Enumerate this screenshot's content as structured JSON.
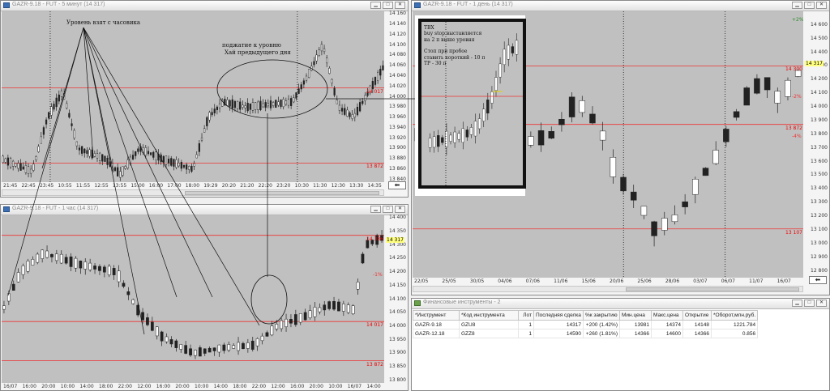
{
  "windows": {
    "top_left": {
      "title": "GAZR-9.18 - FUT - 5 минут (14 317)"
    },
    "bottom_left": {
      "title": "GAZR-9.18 - FUT - 1 час (14 317)"
    },
    "right": {
      "title": "GAZR-9.18 - FUT - 1 день (14 317)"
    },
    "instruments": {
      "title": "Финансовые инструменты - 2"
    }
  },
  "chart_data": [
    {
      "type": "candlestick",
      "timeframe": "5 минут",
      "yticks": [
        "14 160",
        "14 140",
        "14 120",
        "14 100",
        "14 080",
        "14 060",
        "14 040",
        "14 020",
        "14 000",
        "13 980",
        "13 960",
        "13 940",
        "13 920",
        "13 900",
        "13 880",
        "13 860",
        "13 840"
      ],
      "xticks": [
        "21:45",
        "22:45",
        "23:45",
        "10:55",
        "11:55",
        "12:55",
        "13:55",
        "15:00",
        "16:00",
        "17:00",
        "18:00",
        "19:29",
        "20:20",
        "21:20",
        "22:20",
        "23:20",
        "10:30",
        "11:30",
        "12:30",
        "13:30",
        "14:35"
      ],
      "ylim": [
        13835,
        14165
      ],
      "hlines": [
        14017,
        13872
      ],
      "hline_labels": [
        "14 017",
        "13 872"
      ]
    },
    {
      "type": "candlestick",
      "timeframe": "1 час",
      "yticks": [
        "14 400",
        "14 350",
        "14 300",
        "14 250",
        "14 200",
        "14 150",
        "14 100",
        "14 050",
        "14 000",
        "13 950",
        "13 900",
        "13 850",
        "13 800"
      ],
      "xticks": [
        "16/07",
        "16:00",
        "20:00",
        "10:00",
        "14:00",
        "18:00",
        "22:00",
        "12:00",
        "16:00",
        "20:00",
        "10:00",
        "14:00",
        "18:00",
        "22:00",
        "12:00",
        "16:00",
        "20:00",
        "10:00",
        "16/07",
        "14:00"
      ],
      "ylim": [
        13790,
        14410
      ],
      "hlines": [
        14336,
        14017,
        13872
      ],
      "hline_labels": [
        "14 336",
        "14 017",
        "13 872"
      ],
      "percent_labels": [
        "-1%"
      ],
      "current": "14 317"
    },
    {
      "type": "candlestick",
      "timeframe": "1 день",
      "yticks": [
        "14 600",
        "14 500",
        "14 400",
        "14 300",
        "14 200",
        "14 100",
        "14 000",
        "13 900",
        "13 800",
        "13 700",
        "13 600",
        "13 500",
        "13 400",
        "13 300",
        "13 200",
        "13 100",
        "13 000",
        "12 900",
        "12 800"
      ],
      "xticks": [
        "22/05",
        "25/05",
        "30/05",
        "04/06",
        "07/06",
        "11/06",
        "15/06",
        "20/06",
        "25/06",
        "28/06",
        "03/07",
        "06/07",
        "11/07",
        "16/07"
      ],
      "ylim": [
        12750,
        14700
      ],
      "hlines": [
        14300,
        13872,
        13107
      ],
      "hline_labels": [
        "14 300",
        "13 872",
        "13 107"
      ],
      "percent_labels": [
        "+2%",
        "-2%",
        "-4%"
      ],
      "current": "14 317"
    }
  ],
  "annotations": {
    "level": "Уровень взят с часовика",
    "approach_line1": "поджатие к уровню",
    "approach_line2": "Хай предыдущего дня",
    "note": [
      "ТВХ",
      "buy stop выставляется",
      "на 2 п выше уровня",
      "",
      "Стоп при пробое",
      "ставить короткий - 10 п",
      "ТР - 30 п"
    ]
  },
  "table": {
    "headers": [
      "*Инструмент",
      "*Код инструмента",
      "Лот",
      "Последняя сделка",
      "%к закрытию",
      "Мин.цена",
      "Макс.цена",
      "Открытие",
      "*Оборот,млн.руб."
    ],
    "rows": [
      [
        "GAZR-9.18",
        "GZU8",
        "1",
        "14317",
        "+200 (1.42%)",
        "13981",
        "14374",
        "14148",
        "1221.784"
      ],
      [
        "GAZR-12.18",
        "GZZ8",
        "1",
        "14590",
        "+260 (1.81%)",
        "14366",
        "14600",
        "14366",
        "0.856"
      ]
    ]
  }
}
